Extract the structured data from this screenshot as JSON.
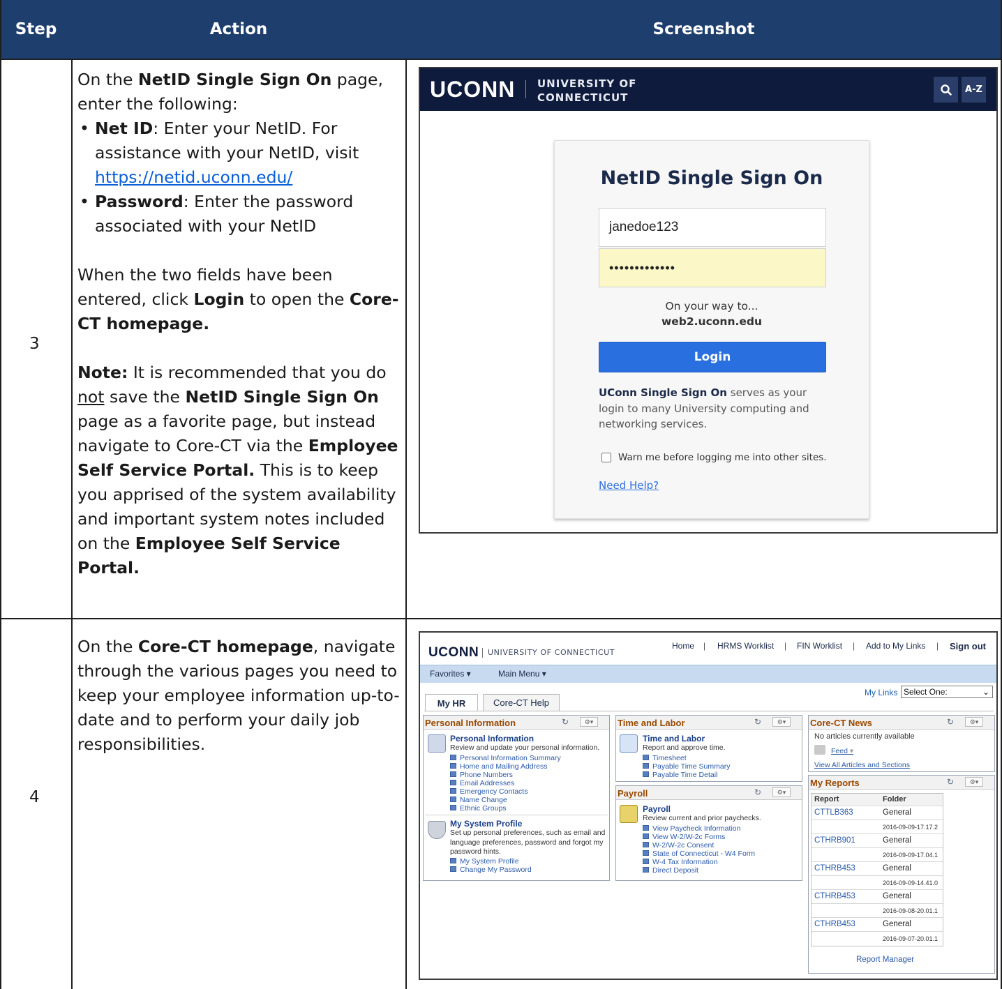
{
  "table": {
    "headers": {
      "step": "Step",
      "action": "Action",
      "screenshot": "Screenshot"
    },
    "rows": [
      {
        "step": "3",
        "action": {
          "p1_pre": "On the ",
          "p1_bold": "NetID Single Sign On",
          "p1_post": " page, enter the following:",
          "b1_bold": "Net ID",
          "b1_text": ": Enter your NetID. For assistance with your NetID, visit ",
          "b1_link": "https://netid.uconn.edu/",
          "b2_bold": "Password",
          "b2_text": ": Enter the password associated with your NetID",
          "p2_pre": "When the two fields have been entered, click ",
          "p2_bold1": "Login",
          "p2_mid": " to open the ",
          "p2_bold2": "Core-CT homepage.",
          "note_bold": "Note:",
          "note_1": " It is recommended that you do ",
          "note_u": "not",
          "note_2": " save the ",
          "note_b2": "NetID Single Sign On",
          "note_3": " page as a favorite page, but instead navigate to Core-CT via the ",
          "note_b3": "Employee Self Service Portal.",
          "note_4": " This is to keep you apprised of the system availability and important system notes included on the ",
          "note_b4": "Employee Self Service Portal."
        }
      },
      {
        "step": "4",
        "action": {
          "p1_pre": "On the ",
          "p1_bold": "Core-CT homepage",
          "p1_post": ", navigate through the various pages you need to keep your employee information up-to-date and to perform your daily job responsibilities."
        }
      }
    ]
  },
  "sso": {
    "logo": "UCONN",
    "university_line1": "UNIVERSITY OF",
    "university_line2": "CONNECTICUT",
    "search_icon": "search-icon",
    "az_label": "A-Z",
    "title": "NetID Single Sign On",
    "netid_value": "janedoe123",
    "password_value": "•••••••••••••",
    "way_text": "On your way to...",
    "way_host": "web2.uconn.edu",
    "login_label": "Login",
    "desc_bold": "UConn Single Sign On",
    "desc_text": " serves as your login to many University computing and networking services.",
    "warn_label": "Warn me before logging me into other sites.",
    "help_label": "Need Help?",
    "colors": {
      "bar": "#0e1b3d",
      "login": "#2a6fe0",
      "password_bg": "#fbf7c6"
    }
  },
  "corect": {
    "logo": "UCONN",
    "university": "UNIVERSITY OF CONNECTICUT",
    "nav": [
      "Home",
      "HRMS Worklist",
      "FIN Worklist",
      "Add to My Links",
      "Sign out"
    ],
    "menu": [
      "Favorites ▾",
      "Main Menu ▾"
    ],
    "tabs": [
      "My HR",
      "Core-CT Help"
    ],
    "mylinks_label": "My Links",
    "mylinks_value": "Select One:",
    "personal": {
      "header": "Personal Information",
      "title": "Personal Information",
      "desc": "Review and update your personal information.",
      "links": [
        "Personal Information Summary",
        "Home and Mailing Address",
        "Phone Numbers",
        "Email Addresses",
        "Emergency Contacts",
        "Name Change",
        "Ethnic Groups"
      ],
      "profile_title": "My System Profile",
      "profile_desc": "Set up personal preferences, such as email and language preferences, password and forgot my password hints.",
      "profile_links": [
        "My System Profile",
        "Change My Password"
      ]
    },
    "time": {
      "header": "Time and Labor",
      "title": "Time and Labor",
      "desc": "Report and approve time.",
      "links": [
        "Timesheet",
        "Payable Time Summary",
        "Payable Time Detail"
      ]
    },
    "payroll": {
      "header": "Payroll",
      "title": "Payroll",
      "desc": "Review current and prior paychecks.",
      "links": [
        "View Paycheck Information",
        "View W-2/W-2c Forms",
        "W-2/W-2c Consent",
        "State of Connecticut - W4 Form",
        "W-4 Tax Information",
        "Direct Deposit"
      ]
    },
    "news": {
      "header": "Core-CT News",
      "none": "No articles currently available",
      "feed": "Feed",
      "view_all": "View All Articles and Sections"
    },
    "reports": {
      "header": "My Reports",
      "col_report": "Report",
      "col_folder": "Folder",
      "rows": [
        {
          "report": "CTTLB363",
          "folder": "General",
          "date": "2016-09-09-17.17.2"
        },
        {
          "report": "CTHRB901",
          "folder": "General",
          "date": "2016-09-09-17.04.1"
        },
        {
          "report": "CTHRB453",
          "folder": "General",
          "date": "2016-09-09-14.41.0"
        },
        {
          "report": "CTHRB453",
          "folder": "General",
          "date": "2016-09-08-20.01.1"
        },
        {
          "report": "CTHRB453",
          "folder": "General",
          "date": "2016-09-07-20.01.1"
        }
      ],
      "manager": "Report Manager"
    }
  }
}
